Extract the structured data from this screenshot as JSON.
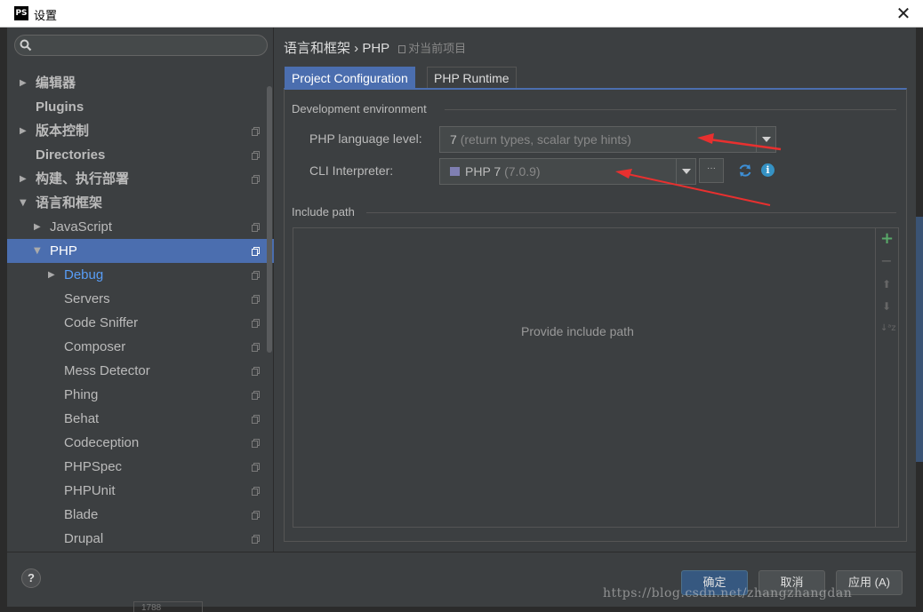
{
  "window": {
    "app_icon": "PS",
    "title": "设置",
    "close_glyph": "✕"
  },
  "sidebar": {
    "search_value": "",
    "items": [
      {
        "label": "编辑器",
        "arrow": "▶",
        "bold": true
      },
      {
        "label": "Plugins",
        "bold": true
      },
      {
        "label": "版本控制",
        "arrow": "▶",
        "bold": true
      },
      {
        "label": "Directories",
        "bold": true
      },
      {
        "label": "构建、执行部署",
        "arrow": "▶",
        "bold": true
      },
      {
        "label": "语言和框架",
        "arrow": "▼",
        "bold": true
      },
      {
        "label": "JavaScript",
        "arrow": "▶"
      },
      {
        "label": "PHP",
        "arrow": "▼",
        "selected": true
      },
      {
        "label": "Debug",
        "arrow": "▶",
        "link": true
      },
      {
        "label": "Servers"
      },
      {
        "label": "Code Sniffer"
      },
      {
        "label": "Composer"
      },
      {
        "label": "Mess Detector"
      },
      {
        "label": "Phing"
      },
      {
        "label": "Behat"
      },
      {
        "label": "Codeception"
      },
      {
        "label": "PHPSpec"
      },
      {
        "label": "PHPUnit"
      },
      {
        "label": "Blade"
      },
      {
        "label": "Drupal"
      }
    ]
  },
  "breadcrumb": {
    "path": "语言和框架 › PHP",
    "scope": "对当前项目"
  },
  "tabs": [
    {
      "label": "Project Configuration",
      "active": true
    },
    {
      "label": "PHP Runtime",
      "active": false
    }
  ],
  "dev_env": {
    "section_title": "Development environment",
    "language_level_label": "PHP language level:",
    "language_level_value": "7",
    "language_level_hint": "(return types, scalar type hints)",
    "cli_label": "CLI Interpreter:",
    "cli_value": "PHP 7",
    "cli_version": "(7.0.9)",
    "more_button": "···",
    "info_glyph": "i"
  },
  "include_path": {
    "section_title": "Include path",
    "empty_text": "Provide include path",
    "toolbar": {
      "add": "+",
      "remove": "−",
      "up": "⬆",
      "down": "⬇",
      "sort": "↓ᵃz"
    }
  },
  "footer": {
    "help": "?",
    "ok": "确定",
    "cancel": "取消",
    "apply": "应用 (A)"
  },
  "background_fragment": "1788",
  "watermark": "https://blog.csdn.net/zhangzhangdan",
  "colors": {
    "accent": "#4b6eaf",
    "annotation_arrow": "#e8302f",
    "add_green": "#59a869"
  }
}
